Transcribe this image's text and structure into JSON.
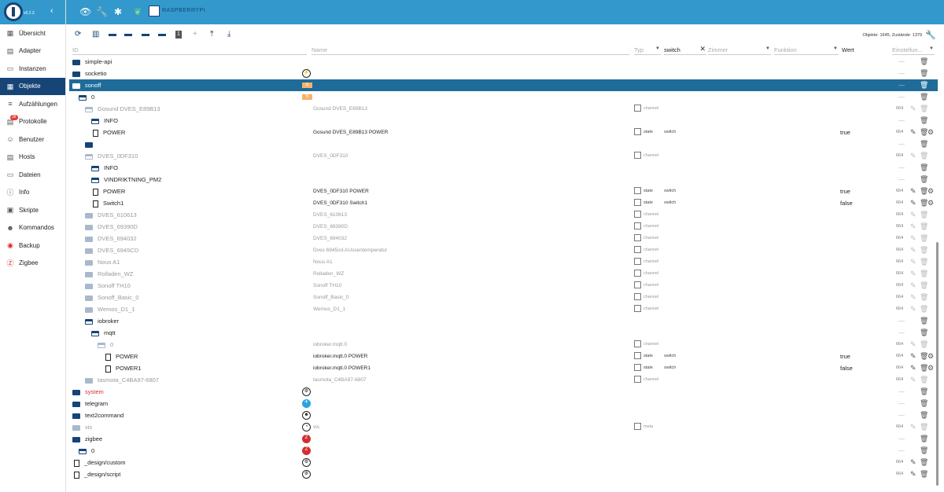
{
  "app": {
    "version": "v5.2.3",
    "hostname": "RASPBERRYPI"
  },
  "sidebar": {
    "items": [
      {
        "label": "Übersicht",
        "icon": "grid-icon",
        "glyph": "▦"
      },
      {
        "label": "Adapter",
        "icon": "store-icon",
        "glyph": "▤"
      },
      {
        "label": "Instanzen",
        "icon": "instances-icon",
        "glyph": "▭"
      },
      {
        "label": "Objekte",
        "icon": "objects-icon",
        "glyph": "▦",
        "active": true
      },
      {
        "label": "Aufzählungen",
        "icon": "enums-icon",
        "glyph": "≡"
      },
      {
        "label": "Protokolle",
        "icon": "logs-icon",
        "glyph": "▤",
        "badge": "38"
      },
      {
        "label": "Benutzer",
        "icon": "user-icon",
        "glyph": "☺"
      },
      {
        "label": "Hosts",
        "icon": "hosts-icon",
        "glyph": "▤"
      },
      {
        "label": "Dateien",
        "icon": "files-icon",
        "glyph": "▭"
      },
      {
        "label": "Info",
        "icon": "info-icon",
        "glyph": "ⓘ"
      },
      {
        "label": "Skripte",
        "icon": "scripts-icon",
        "glyph": "▣"
      },
      {
        "label": "Kommandos",
        "icon": "commands-icon",
        "glyph": "☻"
      },
      {
        "label": "Backup",
        "icon": "backup-icon",
        "glyph": "◉"
      },
      {
        "label": "Zigbee",
        "icon": "zigbee-icon",
        "glyph": "Ⓩ"
      }
    ]
  },
  "toolbar": {
    "stats": "Objekte: 1645, Zustände: 1379"
  },
  "filters": {
    "id_placeholder": "ID",
    "name_placeholder": "Name",
    "type_placeholder": "Typ",
    "role_value": "switch",
    "room_placeholder": "Zimmer",
    "function_placeholder": "Funktion",
    "value_header": "Wert",
    "settings_header": "Einstellun..."
  },
  "rows": [
    {
      "level": 0,
      "kind": "folder",
      "id": "simple-api"
    },
    {
      "level": 0,
      "kind": "folder",
      "id": "socketio",
      "icon": "⚡"
    },
    {
      "level": 0,
      "kind": "folder",
      "id": "sonoff",
      "selected": true,
      "icon": "S"
    },
    {
      "level": 1,
      "kind": "folder-open",
      "id": "0",
      "icon": "S"
    },
    {
      "level": 2,
      "kind": "folder-open",
      "id": "Gosund DVES_E89B13",
      "name": "Gosund DVES_E89B13",
      "type": "channel",
      "dim": true,
      "acl": "664"
    },
    {
      "level": 3,
      "kind": "folder-open",
      "id": "INFO"
    },
    {
      "level": 3,
      "kind": "file",
      "id": "POWER",
      "name": "Gosund DVES_E89B13 POWER",
      "type": "state",
      "role": "switch",
      "value": "true",
      "acl": "664",
      "gear": true
    },
    {
      "level": 2,
      "kind": "folder",
      "id": ""
    },
    {
      "level": 2,
      "kind": "folder-open",
      "id": "DVES_0DF310",
      "name": "DVES_0DF310",
      "type": "channel",
      "dim": true,
      "acl": "664"
    },
    {
      "level": 3,
      "kind": "folder-open",
      "id": "INFO"
    },
    {
      "level": 3,
      "kind": "folder-open",
      "id": "VINDRIKTNING_PM2"
    },
    {
      "level": 3,
      "kind": "file",
      "id": "POWER",
      "name": "DVES_0DF310 POWER",
      "type": "state",
      "role": "switch",
      "value": "true",
      "acl": "664",
      "gear": true
    },
    {
      "level": 3,
      "kind": "file",
      "id": "Switch1",
      "name": "DVES_0DF310 Switch1",
      "type": "state",
      "role": "switch",
      "value": "false",
      "acl": "664",
      "gear": true
    },
    {
      "level": 2,
      "kind": "folder",
      "id": "DVES_610613",
      "name": "DVES_610613",
      "type": "channel",
      "dim": true,
      "acl": "664"
    },
    {
      "level": 2,
      "kind": "folder",
      "id": "DVES_69390D",
      "name": "DVES_69390D",
      "type": "channel",
      "dim": true,
      "acl": "664"
    },
    {
      "level": 2,
      "kind": "folder",
      "id": "DVES_694032",
      "name": "DVES_694032",
      "type": "channel",
      "dim": true,
      "acl": "664"
    },
    {
      "level": 2,
      "kind": "folder",
      "id": "DVES_6945CD",
      "name": "Dves 6945cd-AUssentemperatur",
      "type": "channel",
      "dim": true,
      "acl": "664"
    },
    {
      "level": 2,
      "kind": "folder",
      "id": "Nous A1",
      "name": "Nous A1",
      "type": "channel",
      "dim": true,
      "acl": "664"
    },
    {
      "level": 2,
      "kind": "folder",
      "id": "Rolladen_WZ",
      "name": "Rolladen_WZ",
      "type": "channel",
      "dim": true,
      "acl": "664"
    },
    {
      "level": 2,
      "kind": "folder",
      "id": "Sonoff TH10",
      "name": "Sonoff TH10",
      "type": "channel",
      "dim": true,
      "acl": "664"
    },
    {
      "level": 2,
      "kind": "folder",
      "id": "Sonoff_Basic_0",
      "name": "Sonoff_Basic_0",
      "type": "channel",
      "dim": true,
      "acl": "664"
    },
    {
      "level": 2,
      "kind": "folder",
      "id": "Wemos_D1_1",
      "name": "Wemos_D1_1",
      "type": "channel",
      "dim": true,
      "acl": "664"
    },
    {
      "level": 2,
      "kind": "folder-open",
      "id": "iobroker"
    },
    {
      "level": 3,
      "kind": "folder-open",
      "id": "mqtt"
    },
    {
      "level": 4,
      "kind": "folder-open",
      "id": "0",
      "name": "iobroker.mqtt.0",
      "type": "channel",
      "dim": true,
      "acl": "664"
    },
    {
      "level": 5,
      "kind": "file",
      "id": "POWER",
      "name": "iobroker.mqtt.0 POWER",
      "type": "state",
      "role": "switch",
      "value": "true",
      "acl": "664",
      "gear": true
    },
    {
      "level": 5,
      "kind": "file",
      "id": "POWER1",
      "name": "iobroker.mqtt.0 POWER1",
      "type": "state",
      "role": "switch",
      "value": "false",
      "acl": "664",
      "gear": true
    },
    {
      "level": 2,
      "kind": "folder",
      "id": "tasmota_C4BA97-6807",
      "name": "tasmota_C4BA97-6807",
      "type": "channel",
      "dim": true,
      "acl": "664"
    },
    {
      "level": 0,
      "kind": "folder",
      "id": "system",
      "red": true,
      "icon": "⚙"
    },
    {
      "level": 0,
      "kind": "folder",
      "id": "telegram",
      "icon": "✈"
    },
    {
      "level": 0,
      "kind": "folder",
      "id": "text2command",
      "icon": "☻"
    },
    {
      "level": 0,
      "kind": "folder",
      "id": "vis",
      "name": "vis",
      "type": "meta",
      "dim": true,
      "acl": "664",
      "icon": "◔"
    },
    {
      "level": 0,
      "kind": "folder",
      "id": "zigbee",
      "icon": "Z"
    },
    {
      "level": 1,
      "kind": "folder-open",
      "id": "0",
      "icon": "Z"
    },
    {
      "level": 0,
      "kind": "file",
      "id": "_design/custom",
      "icon": "⚙",
      "acl": "664"
    },
    {
      "level": 0,
      "kind": "file",
      "id": "_design/script",
      "icon": "⚙",
      "acl": "664"
    }
  ]
}
